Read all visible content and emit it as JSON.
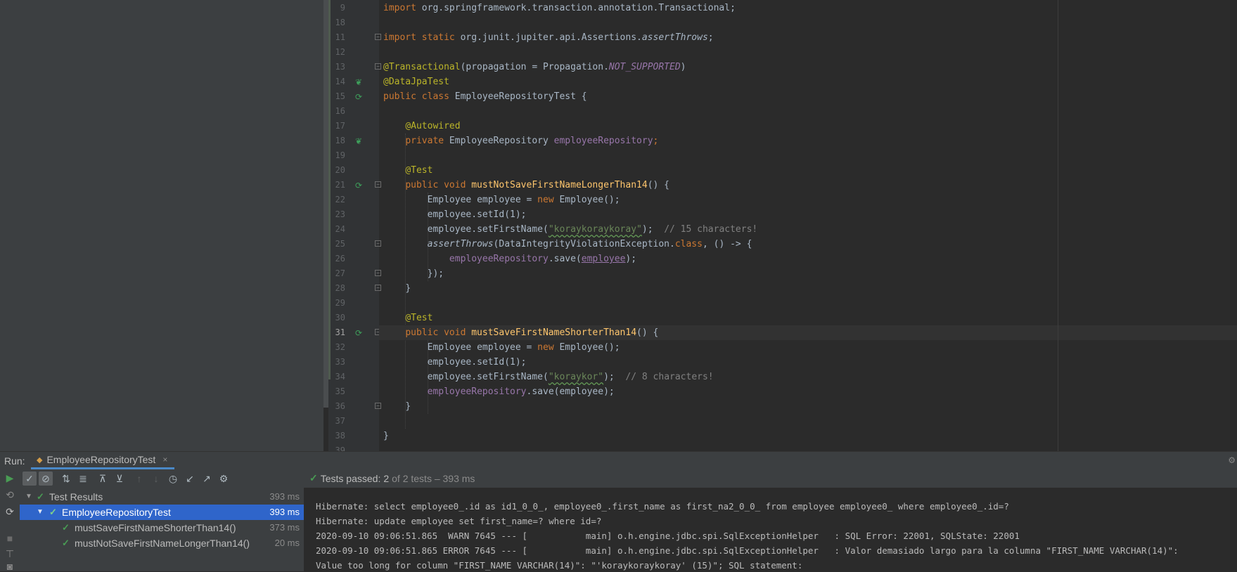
{
  "editor": {
    "line_numbers": [
      "9",
      "18",
      "11",
      "12",
      "13",
      "14",
      "15",
      "16",
      "17",
      "18",
      "19",
      "20",
      "21",
      "22",
      "23",
      "24",
      "25",
      "26",
      "27",
      "28",
      "29",
      "30",
      "31",
      "32",
      "33",
      "34",
      "35",
      "36",
      "37",
      "38",
      "39"
    ],
    "current_line": "31",
    "lines": {
      "l1_import": "import",
      "l1_rest": " org.springframework.transaction.annotation.Transactional;",
      "l3_import": "import static",
      "l3_rest": " org.junit.jupiter.api.Assertions.",
      "l3_method": "assertThrows",
      "l3_end": ";",
      "l5_ann": "@Transactional",
      "l5_a": "(propagation = Propagation.",
      "l5_const": "NOT_SUPPORTED",
      "l5_b": ")",
      "l6_ann": "@DataJpaTest",
      "l7_kw": "public class",
      "l7_rest": " EmployeeRepositoryTest {",
      "l9_ann": "@Autowired",
      "l10_kw": "private",
      "l10_type": " EmployeeRepository ",
      "l10_field": "employeeRepository",
      "l10_end": ";",
      "l12_ann": "@Test",
      "l13_kw": "public void",
      "l13_method": "mustNotSaveFirstNameLongerThan14",
      "l13_end": "() {",
      "l14_a": "Employee employee = ",
      "l14_kw": "new",
      "l14_b": " Employee();",
      "l15": "employee.setId(1);",
      "l16_a": "employee.setFirstName(",
      "l16_str": "\"koraykoraykoray\"",
      "l16_b": ");  ",
      "l16_cm": "// 15 characters!",
      "l17_m": "assertThrows",
      "l17_a": "(DataIntegrityViolationException.",
      "l17_kw": "class",
      "l17_b": ", () -> {",
      "l18_field": "employeeRepository",
      "l18_a": ".save(",
      "l18_var": "employee",
      "l18_b": ");",
      "l19": "});",
      "l20": "}",
      "l22_ann": "@Test",
      "l23_kw": "public void",
      "l23_method": "mustSaveFirstNameShorterThan14",
      "l23_end": "() {",
      "l24_a": "Employee employee = ",
      "l24_kw": "new",
      "l24_b": " Employee();",
      "l25": "employee.setId(1);",
      "l26_a": "employee.setFirstName(",
      "l26_str": "\"koraykor\"",
      "l26_b": ");  ",
      "l26_cm": "// 8 characters!",
      "l27_field": "employeeRepository",
      "l27_a": ".save(employee);",
      "l28": "}",
      "l30": "}"
    }
  },
  "run_panel": {
    "label": "Run:",
    "tab_label": "EmployeeRepositoryTest",
    "close": "×",
    "status_prefix": "Tests passed:",
    "status_count": "2",
    "status_suffix": "of 2 tests – 393 ms",
    "tree": [
      {
        "name": "Test Results",
        "time": "393 ms"
      },
      {
        "name": "EmployeeRepositoryTest",
        "time": "393 ms"
      },
      {
        "name": "mustSaveFirstNameShorterThan14()",
        "time": "373 ms"
      },
      {
        "name": "mustNotSaveFirstNameLongerThan14()",
        "time": "20 ms"
      }
    ],
    "console": [
      "Hibernate: select employee0_.id as id1_0_0_, employee0_.first_name as first_na2_0_0_ from employee employee0_ where employee0_.id=?",
      "Hibernate: update employee set first_name=? where id=?",
      "2020-09-10 09:06:51.865  WARN 7645 --- [           main] o.h.engine.jdbc.spi.SqlExceptionHelper   : SQL Error: 22001, SQLState: 22001",
      "2020-09-10 09:06:51.865 ERROR 7645 --- [           main] o.h.engine.jdbc.spi.SqlExceptionHelper   : Valor demasiado largo para la columna \"FIRST_NAME VARCHAR(14)\":",
      "Value too long for column \"FIRST_NAME VARCHAR(14)\": \"'koraykoraykoray' (15)\"; SQL statement:"
    ]
  },
  "colors": {
    "editor_bg": "#2b2b2b",
    "keyword": "#cc7832",
    "annotation": "#bbb529",
    "string": "#6a8759",
    "field": "#9876aa",
    "selection": "#2f65ca",
    "pass_green": "#499c54"
  },
  "icons": [
    "spring-bean-icon",
    "run-test-icon",
    "fold-icon",
    "rerun-icon",
    "check-icon",
    "stop-icon",
    "sort-icon",
    "expand-icon",
    "collapse-icon",
    "history-icon",
    "export-icon",
    "gear-icon",
    "camera-icon"
  ]
}
